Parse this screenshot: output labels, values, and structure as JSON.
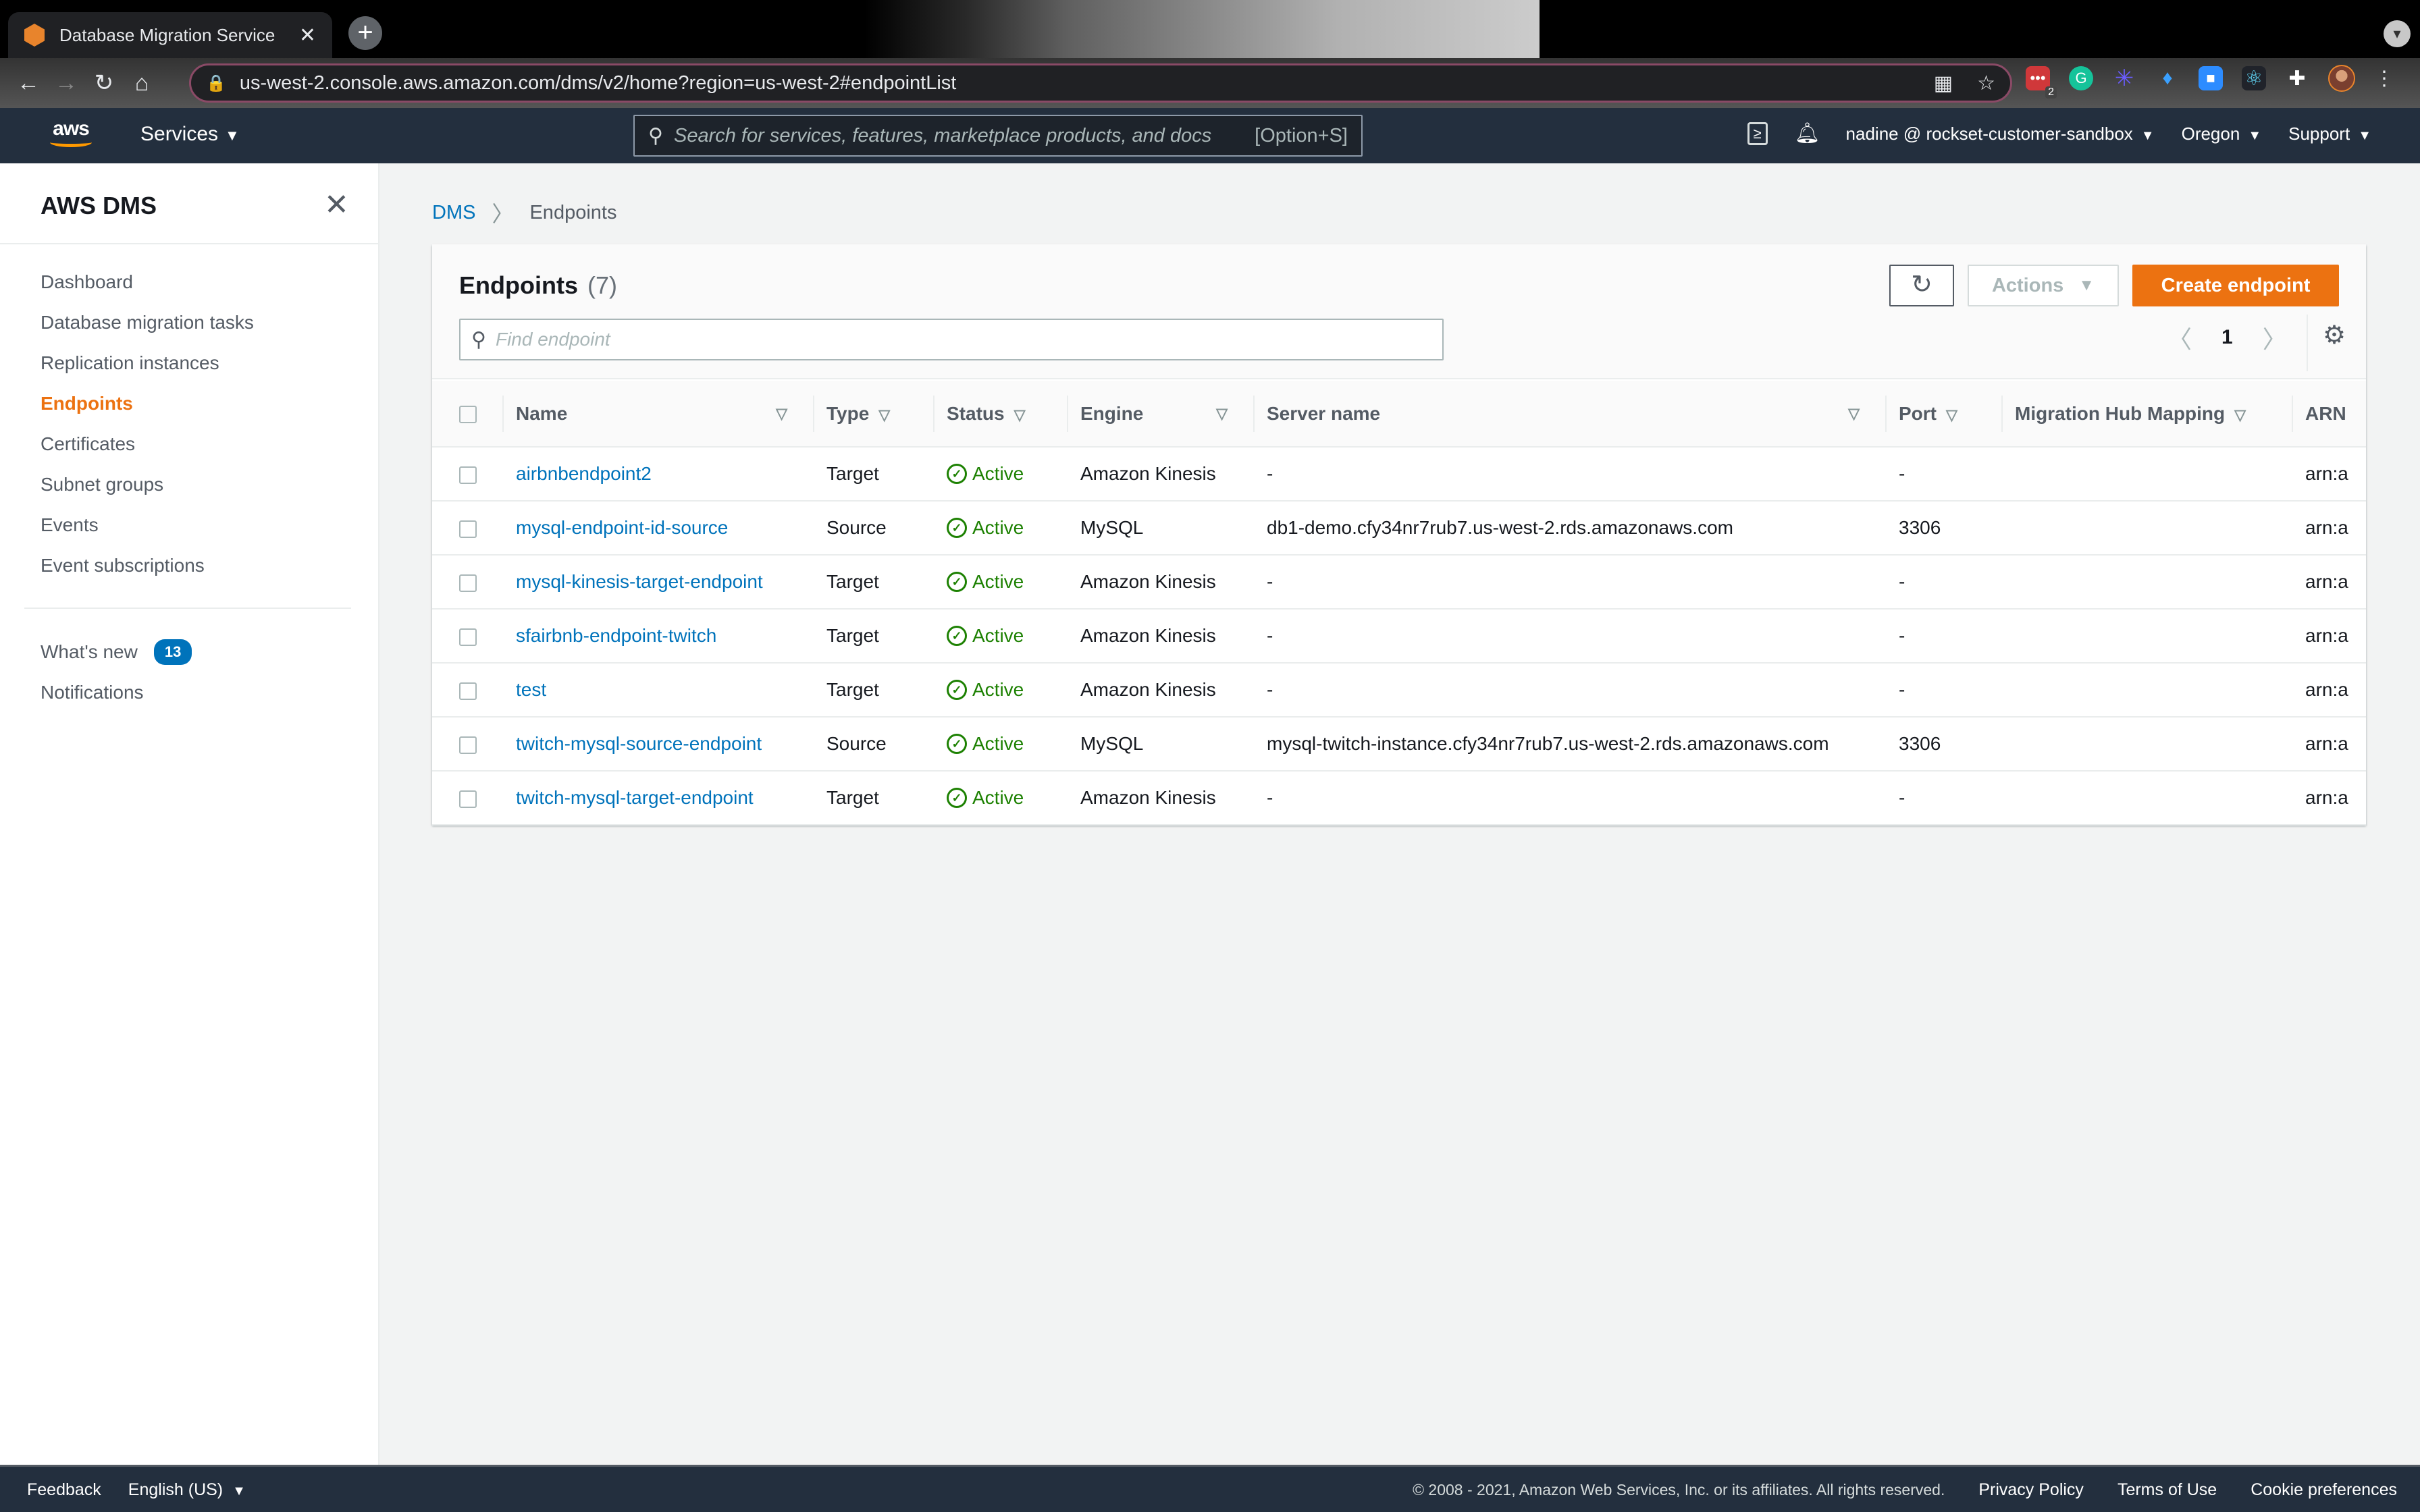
{
  "browser": {
    "tab_title": "Database Migration Service",
    "url": "us-west-2.console.aws.amazon.com/dms/v2/home?region=us-west-2#endpointList",
    "extension_badge": "2"
  },
  "header": {
    "logo": "aws",
    "services_label": "Services",
    "search_placeholder": "Search for services, features, marketplace products, and docs",
    "search_shortcut": "[Option+S]",
    "account_label": "nadine @ rockset-customer-sandbox",
    "region_label": "Oregon",
    "support_label": "Support"
  },
  "sidebar": {
    "title": "AWS DMS",
    "items": [
      {
        "label": "Dashboard",
        "active": false
      },
      {
        "label": "Database migration tasks",
        "active": false
      },
      {
        "label": "Replication instances",
        "active": false
      },
      {
        "label": "Endpoints",
        "active": true
      },
      {
        "label": "Certificates",
        "active": false
      },
      {
        "label": "Subnet groups",
        "active": false
      },
      {
        "label": "Events",
        "active": false
      },
      {
        "label": "Event subscriptions",
        "active": false
      }
    ],
    "secondary": {
      "whats_new_label": "What's new",
      "whats_new_count": "13",
      "notifications_label": "Notifications"
    }
  },
  "breadcrumb": {
    "root": "DMS",
    "current": "Endpoints"
  },
  "panel": {
    "title": "Endpoints",
    "count": "(7)",
    "actions_label": "Actions",
    "create_label": "Create endpoint",
    "find_placeholder": "Find endpoint",
    "page": "1"
  },
  "table": {
    "columns": [
      "Name",
      "Type",
      "Status",
      "Engine",
      "Server name",
      "Port",
      "Migration Hub Mapping",
      "ARN"
    ],
    "rows": [
      {
        "name": "airbnbendpoint2",
        "type": "Target",
        "status": "Active",
        "engine": "Amazon Kinesis",
        "server": "-",
        "port": "-",
        "hub": "",
        "arn": "arn:a"
      },
      {
        "name": "mysql-endpoint-id-source",
        "type": "Source",
        "status": "Active",
        "engine": "MySQL",
        "server": "db1-demo.cfy34nr7rub7.us-west-2.rds.amazonaws.com",
        "port": "3306",
        "hub": "",
        "arn": "arn:a"
      },
      {
        "name": "mysql-kinesis-target-endpoint",
        "type": "Target",
        "status": "Active",
        "engine": "Amazon Kinesis",
        "server": "-",
        "port": "-",
        "hub": "",
        "arn": "arn:a"
      },
      {
        "name": "sfairbnb-endpoint-twitch",
        "type": "Target",
        "status": "Active",
        "engine": "Amazon Kinesis",
        "server": "-",
        "port": "-",
        "hub": "",
        "arn": "arn:a"
      },
      {
        "name": "test",
        "type": "Target",
        "status": "Active",
        "engine": "Amazon Kinesis",
        "server": "-",
        "port": "-",
        "hub": "",
        "arn": "arn:a"
      },
      {
        "name": "twitch-mysql-source-endpoint",
        "type": "Source",
        "status": "Active",
        "engine": "MySQL",
        "server": "mysql-twitch-instance.cfy34nr7rub7.us-west-2.rds.amazonaws.com",
        "port": "3306",
        "hub": "",
        "arn": "arn:a"
      },
      {
        "name": "twitch-mysql-target-endpoint",
        "type": "Target",
        "status": "Active",
        "engine": "Amazon Kinesis",
        "server": "-",
        "port": "-",
        "hub": "",
        "arn": "arn:a"
      }
    ]
  },
  "footer": {
    "feedback_label": "Feedback",
    "language_label": "English (US)",
    "copyright": "© 2008 - 2021, Amazon Web Services, Inc. or its affiliates. All rights reserved.",
    "privacy_label": "Privacy Policy",
    "terms_label": "Terms of Use",
    "cookie_label": "Cookie preferences"
  },
  "colors": {
    "accent": "#ec7211",
    "link": "#0073bb",
    "success": "#1d8102",
    "nav_bg": "#232f3e"
  }
}
